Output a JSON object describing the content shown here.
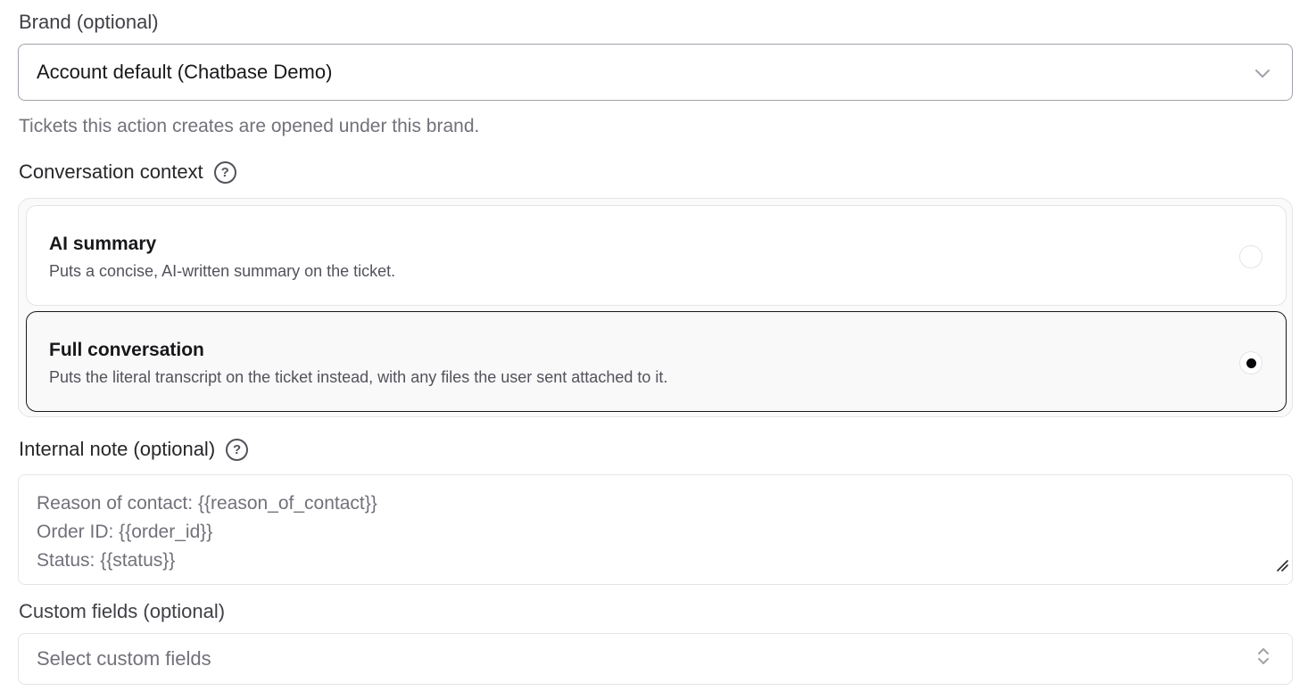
{
  "brand": {
    "label": "Brand (optional)",
    "value": "Account default (Chatbase Demo)",
    "hint": "Tickets this action creates are opened under this brand."
  },
  "context": {
    "label": "Conversation context",
    "help_icon": "question-circle-icon",
    "options": [
      {
        "title": "AI summary",
        "description": "Puts a concise, AI-written summary on the ticket.",
        "selected": false
      },
      {
        "title": "Full conversation",
        "description": "Puts the literal transcript on the ticket instead, with any files the user sent attached to it.",
        "selected": true
      }
    ]
  },
  "note": {
    "label": "Internal note (optional)",
    "help_icon": "question-circle-icon",
    "placeholder_lines": [
      "Reason of contact: {{reason_of_contact}}",
      "Order ID: {{order_id}}",
      "Status: {{status}}"
    ]
  },
  "custom_fields": {
    "label": "Custom fields (optional)",
    "placeholder": "Select custom fields"
  }
}
